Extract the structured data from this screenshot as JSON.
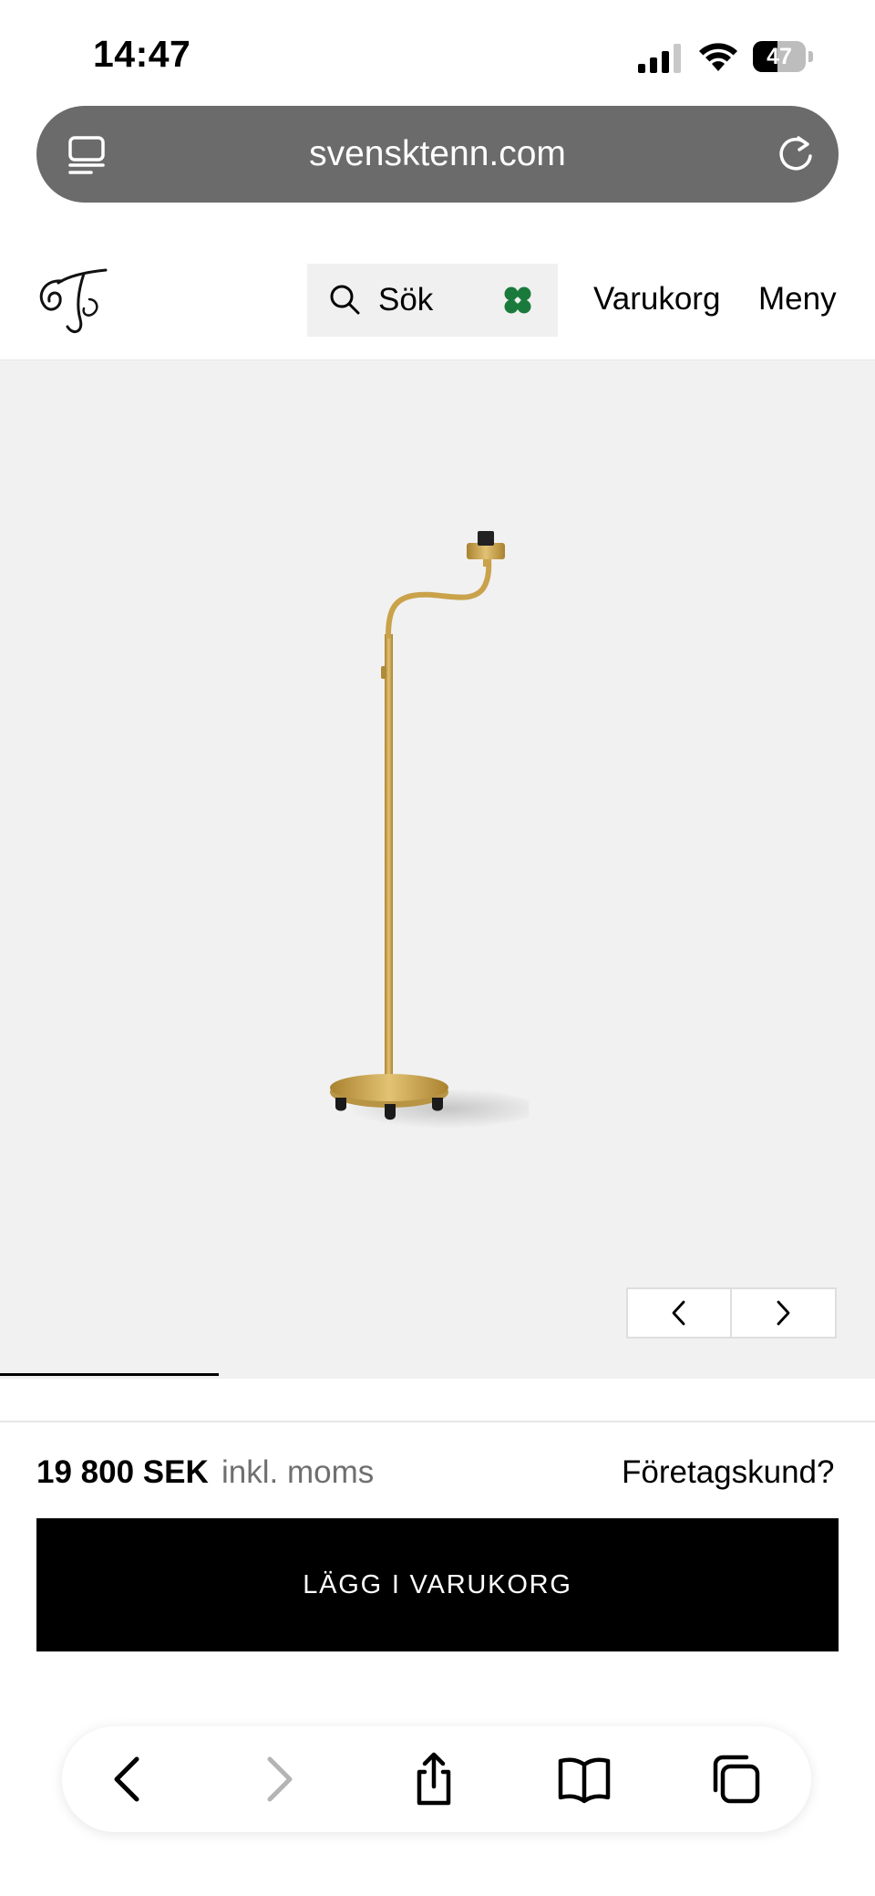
{
  "status_bar": {
    "time": "14:47",
    "battery_level": "47",
    "icons": [
      "cellular-signal-icon",
      "wifi-icon",
      "battery-icon"
    ]
  },
  "browser": {
    "url": "svensktenn.com",
    "icons": [
      "tabs-overview-icon",
      "reload-icon"
    ]
  },
  "header": {
    "logo": "ST",
    "search_label": "Sök",
    "icons": [
      "search-icon",
      "four-leaf-clover-icon"
    ],
    "cart_label": "Varukorg",
    "menu_label": "Meny"
  },
  "gallery": {
    "icons": [
      "chevron-left-icon",
      "chevron-right-icon"
    ],
    "progress": 0.25
  },
  "product": {
    "price": "19 800 SEK",
    "price_note": "inkl. moms",
    "business_link": "Företagskund?",
    "add_to_cart_label": "LÄGG I VARUKORG"
  },
  "toolbar": {
    "icons": [
      "back-icon",
      "forward-icon",
      "share-icon",
      "bookmarks-icon",
      "tabs-icon"
    ]
  },
  "colors": {
    "url_bar": "#6b6b6b",
    "stage_background": "#f1f1f1",
    "brass": "#c9a24a",
    "clover_green": "#1a7a3c",
    "button_black": "#000000"
  }
}
